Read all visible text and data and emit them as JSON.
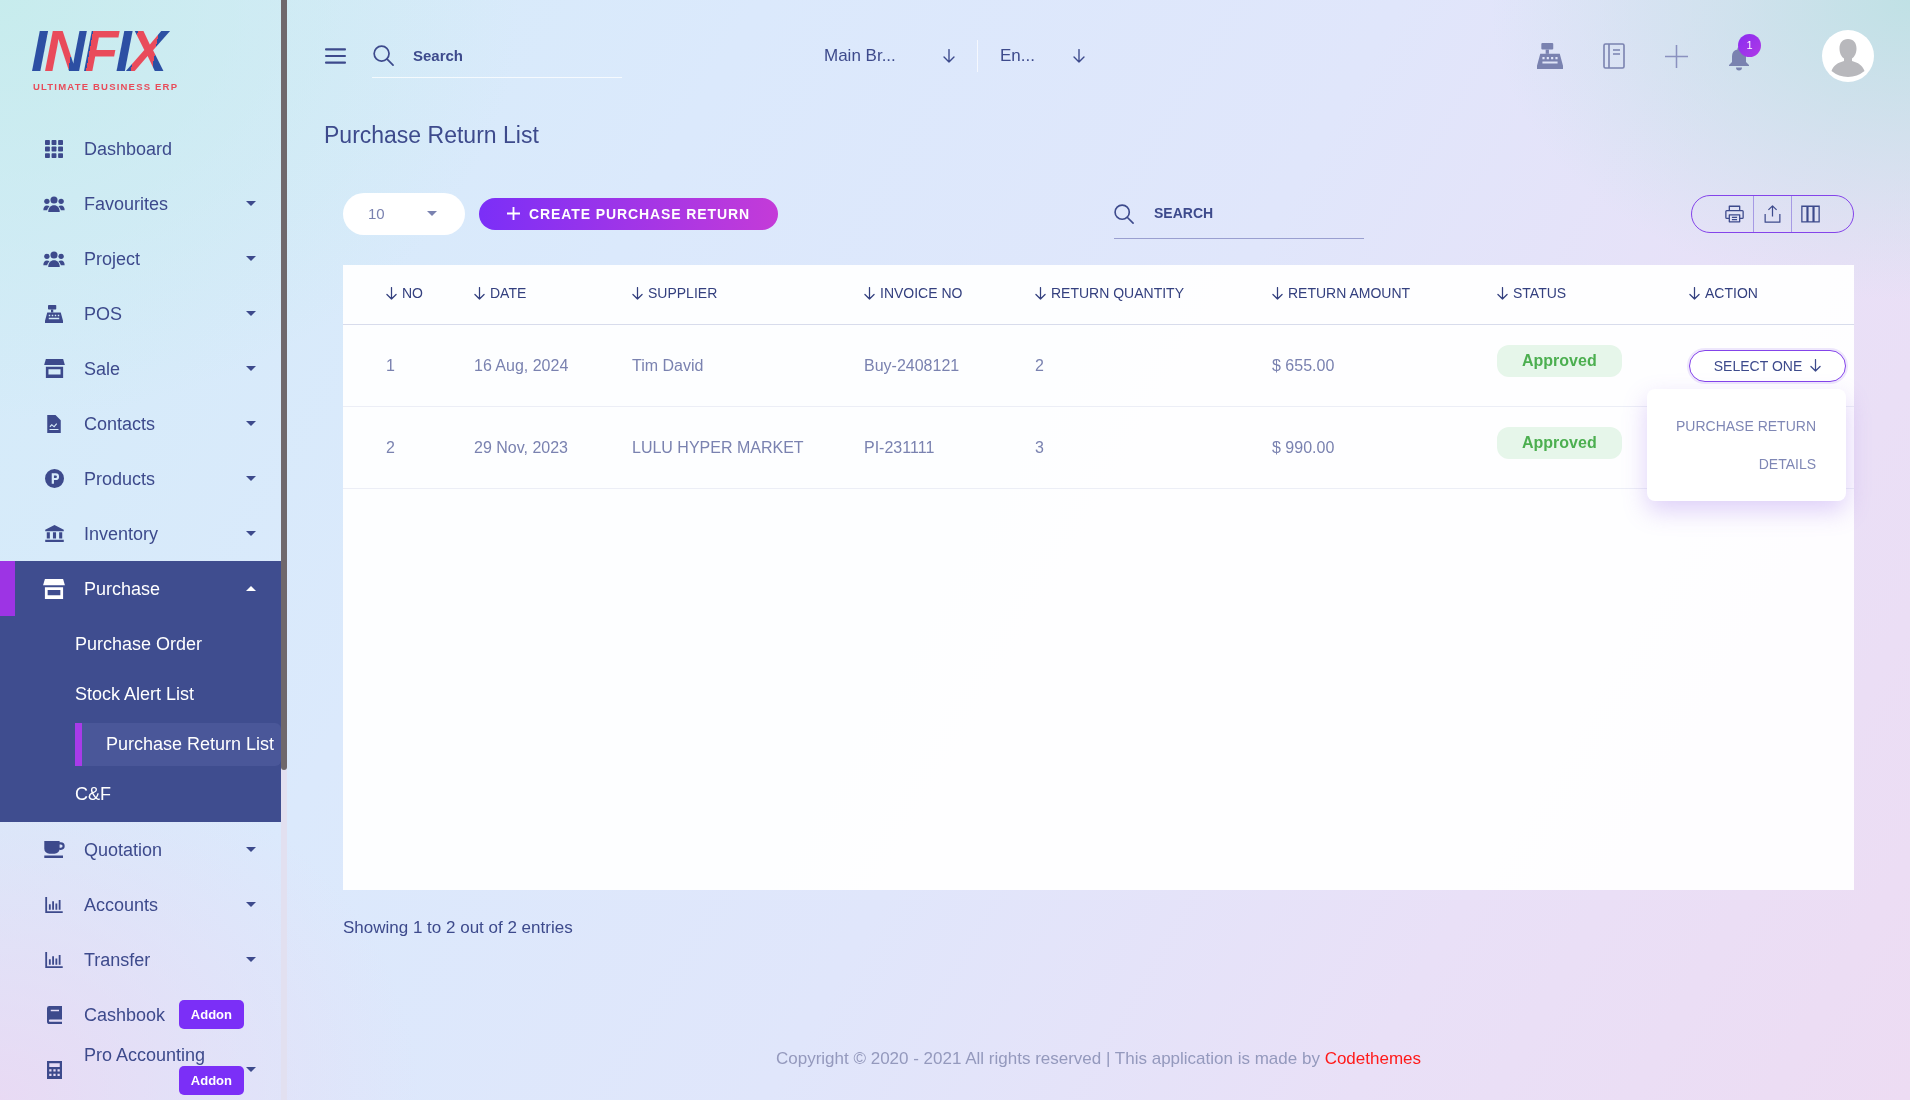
{
  "logo": {
    "name": "INFIX",
    "tagline": "ULTIMATE BUSINESS ERP"
  },
  "sidebar": {
    "items": [
      {
        "label": "Dashboard",
        "kind": "link",
        "selected": false
      },
      {
        "label": "Favourites",
        "kind": "group",
        "selected": false,
        "expanded": false
      },
      {
        "label": "Project",
        "kind": "group",
        "selected": false,
        "expanded": false
      },
      {
        "label": "POS",
        "kind": "group",
        "selected": false,
        "expanded": false
      },
      {
        "label": "Sale",
        "kind": "group",
        "selected": false,
        "expanded": false
      },
      {
        "label": "Contacts",
        "kind": "group",
        "selected": false,
        "expanded": false
      },
      {
        "label": "Products",
        "kind": "group",
        "selected": false,
        "expanded": false
      },
      {
        "label": "Inventory",
        "kind": "group",
        "selected": false,
        "expanded": false
      },
      {
        "label": "Purchase",
        "kind": "group",
        "selected": true,
        "expanded": true,
        "children": [
          {
            "label": "Purchase Order",
            "selected": false
          },
          {
            "label": "Stock Alert List",
            "selected": false
          },
          {
            "label": "Purchase Return List",
            "selected": true
          },
          {
            "label": "C&F",
            "selected": false
          }
        ]
      },
      {
        "label": "Quotation",
        "kind": "group",
        "selected": false,
        "expanded": false
      },
      {
        "label": "Accounts",
        "kind": "group",
        "selected": false,
        "expanded": false
      },
      {
        "label": "Transfer",
        "kind": "group",
        "selected": false,
        "expanded": false
      },
      {
        "label": "Cashbook",
        "kind": "link",
        "selected": false,
        "badge": "Addon"
      },
      {
        "label": "Pro Accounting",
        "kind": "group",
        "selected": false,
        "expanded": false,
        "badge": "Addon"
      }
    ]
  },
  "topbar": {
    "search": {
      "placeholder": "Search"
    },
    "branch": {
      "value": "Main Br..."
    },
    "language": {
      "value": "En..."
    },
    "notifications": {
      "count": "1"
    }
  },
  "page": {
    "title": "Purchase Return List"
  },
  "toolbar": {
    "page_size": "10",
    "create_button": "CREATE PURCHASE RETURN",
    "search": {
      "placeholder": "SEARCH"
    }
  },
  "table": {
    "columns": [
      "NO",
      "DATE",
      "SUPPLIER",
      "INVOICE NO",
      "RETURN QUANTITY",
      "RETURN AMOUNT",
      "STATUS",
      "ACTION"
    ],
    "rows": [
      {
        "no": "1",
        "date": "16 Aug, 2024",
        "supplier": "Tim David",
        "invoice_no": "Buy-2408121",
        "return_quantity": "2",
        "return_amount": "$ 655.00",
        "status": "Approved",
        "action": {
          "label": "SELECT ONE",
          "expanded": true,
          "menu": [
            "PURCHASE RETURN",
            "DETAILS"
          ]
        }
      },
      {
        "no": "2",
        "date": "29 Nov, 2023",
        "supplier": "LULU HYPER MARKET",
        "invoice_no": "PI-231111",
        "return_quantity": "3",
        "return_amount": "$ 990.00",
        "status": "Approved"
      }
    ]
  },
  "summary": "Showing 1 to 2 out of 2 entries",
  "footer": {
    "text": "Copyright © 2020 - 2021 All rights reserved | This application is made by",
    "link": "Codethemes"
  }
}
